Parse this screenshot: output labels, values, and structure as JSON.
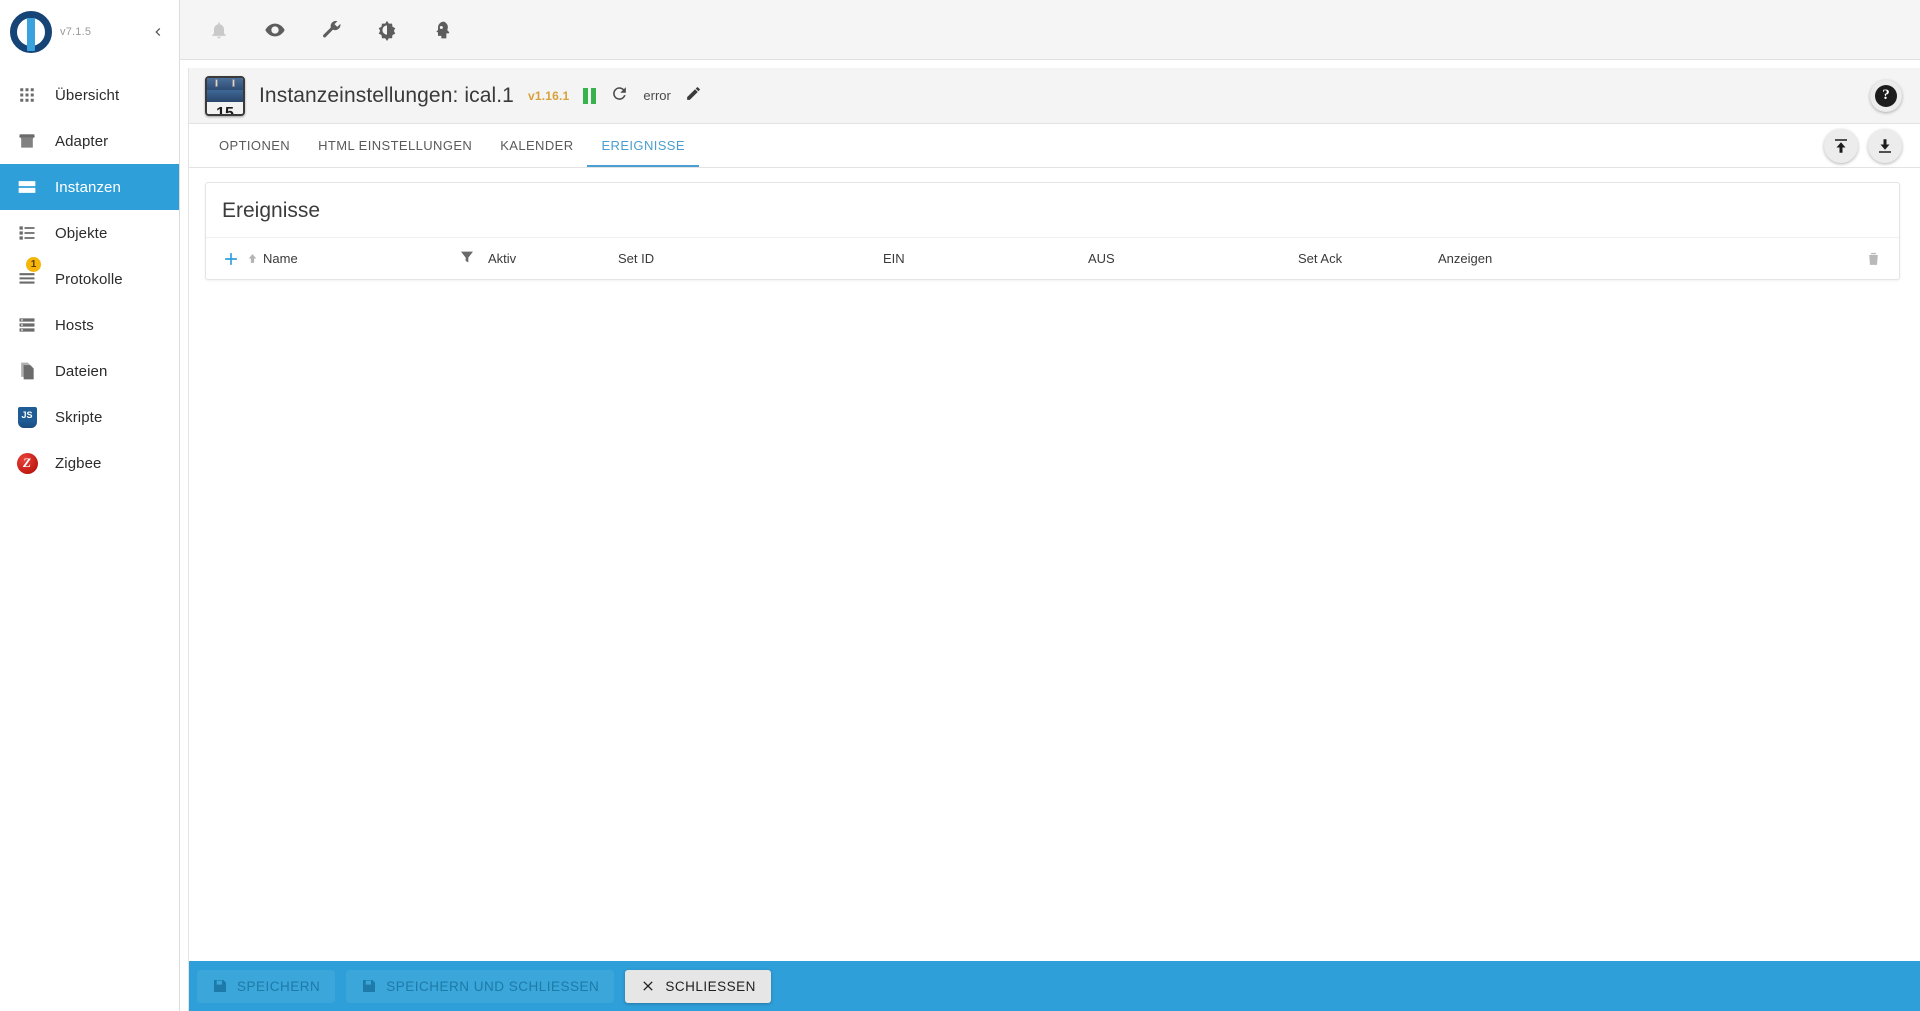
{
  "sidebar": {
    "version": "v7.1.5",
    "collapse_icon": "chevron-left-icon",
    "items": [
      {
        "label": "Übersicht",
        "icon": "grid-icon",
        "active": false,
        "badge": null
      },
      {
        "label": "Adapter",
        "icon": "store-icon",
        "active": false,
        "badge": null
      },
      {
        "label": "Instanzen",
        "icon": "instances-icon",
        "active": true,
        "badge": null
      },
      {
        "label": "Objekte",
        "icon": "list-icon",
        "active": false,
        "badge": null
      },
      {
        "label": "Protokolle",
        "icon": "logs-icon",
        "active": false,
        "badge": "1"
      },
      {
        "label": "Hosts",
        "icon": "server-icon",
        "active": false,
        "badge": null
      },
      {
        "label": "Dateien",
        "icon": "files-icon",
        "active": false,
        "badge": null
      },
      {
        "label": "Skripte",
        "icon": "js-icon",
        "active": false,
        "badge": null
      },
      {
        "label": "Zigbee",
        "icon": "zigbee-icon",
        "active": false,
        "badge": null
      }
    ]
  },
  "topbar": {
    "icons": [
      {
        "name": "bell-icon",
        "title": "Benachrichtigungen",
        "muted": true
      },
      {
        "name": "eye-icon",
        "title": "Ansicht",
        "muted": false
      },
      {
        "name": "wrench-icon",
        "title": "Einstellungen",
        "muted": false
      },
      {
        "name": "brightness-icon",
        "title": "Theme",
        "muted": false
      },
      {
        "name": "expert-head-icon",
        "title": "Expertenmodus",
        "muted": false
      }
    ]
  },
  "instance": {
    "icon": "calendar-icon",
    "calendar_day": "15",
    "title": "Instanzeinstellungen: ical.1",
    "version": "v1.16.1",
    "pause_icon": "pause-icon",
    "refresh_icon": "refresh-icon",
    "status": "error",
    "edit_icon": "pencil-icon",
    "help_icon": "help-icon",
    "help_label": "?"
  },
  "tabs": [
    {
      "label": "Optionen",
      "active": false
    },
    {
      "label": "HTML Einstellungen",
      "active": false
    },
    {
      "label": "Kalender",
      "active": false
    },
    {
      "label": "Ereignisse",
      "active": true
    }
  ],
  "tab_actions": [
    {
      "name": "export-button",
      "icon": "upload-icon"
    },
    {
      "name": "import-button",
      "icon": "download-icon"
    }
  ],
  "table": {
    "title": "Ereignisse",
    "add_label": "+",
    "sort_icon": "arrow-up-icon",
    "filter_icon": "funnel-icon",
    "delete_icon": "trash-icon",
    "columns": [
      {
        "key": "name",
        "label": "Name"
      },
      {
        "key": "aktiv",
        "label": "Aktiv"
      },
      {
        "key": "setid",
        "label": "Set ID"
      },
      {
        "key": "ein",
        "label": "EIN"
      },
      {
        "key": "aus",
        "label": "AUS"
      },
      {
        "key": "setack",
        "label": "Set Ack"
      },
      {
        "key": "anzeigen",
        "label": "Anzeigen"
      }
    ],
    "rows": []
  },
  "footer": {
    "save_label": "Speichern",
    "save_close_label": "Speichern und schliessen",
    "close_label": "Schliessen",
    "save_icon": "floppy-icon",
    "close_icon": "close-icon"
  },
  "colors": {
    "accent": "#2f9fd9",
    "tab_active": "#4a9fd0",
    "badge": "#f5b50a",
    "version": "#d8a23a",
    "run_green": "#37b24d"
  }
}
